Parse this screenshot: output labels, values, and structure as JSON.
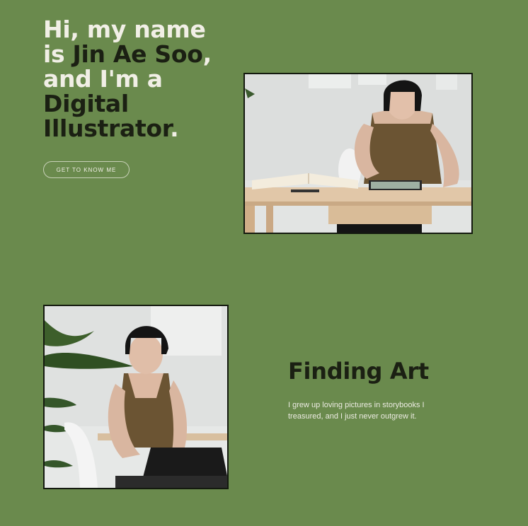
{
  "hero": {
    "line1": "Hi, my name",
    "line2_pre": "is ",
    "name": "Jin Ae Soo",
    "line2_post": ",",
    "line3": "and I'm a",
    "role_line1": "Digital",
    "role_line2": "Illustrator",
    "role_end": ".",
    "cta_label": "GET TO KNOW ME"
  },
  "about": {
    "title": "Finding Art",
    "body": "I grew up loving pictures in storybooks I treasured, and I just never outgrew it."
  },
  "colors": {
    "background": "#6a8a4d",
    "light_text": "#f1efe6",
    "dark_text": "#1b2013"
  }
}
